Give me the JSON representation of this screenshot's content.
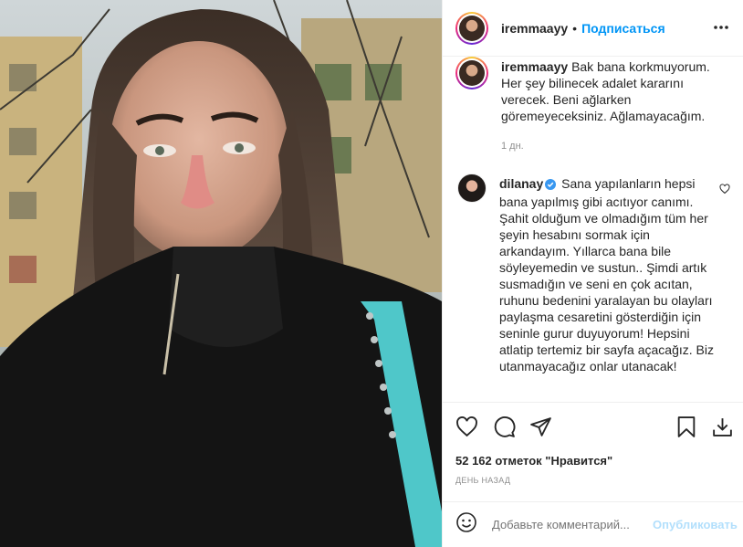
{
  "header": {
    "username": "iremmaayy",
    "separator": "•",
    "follow_label": "Подписаться",
    "more_icon": "more-horizontal-icon"
  },
  "comments": [
    {
      "username": "iremmaayy",
      "text": "Bak bana korkmuyorum. Her şey bilinecek adalet kararını verecek. Beni ağlarken göremeyeceksiniz. Ağlamayacağım.",
      "time": "1 дн."
    },
    {
      "username": "dilanay",
      "verified": true,
      "text": "Sana yapılanların hepsi bana yapılmış gibi acıtıyor canımı. Şahit olduğum ve olmadığım tüm her şeyin hesabını sormak için arkandayım. Yıllarca bana bile söyleyemedin ve sustun.. Şimdi artık susmadığın ve seni en çok acıtan, ruhunu bedenini yaralayan bu olayları paylaşma cesaretini gösterdiğin için seninle gurur duyuyorum! Hepsini atlatip tertemiz bir sayfa açacağız. Biz utanmayacağız onlar utanacak!"
    }
  ],
  "actions": {
    "likes_label": "52 162 отметок \"Нравится\"",
    "time_label": "ДЕНЬ НАЗАД"
  },
  "add_comment": {
    "placeholder": "Добавьте комментарий...",
    "post_label": "Опубликовать"
  },
  "colors": {
    "accent": "#0095f6",
    "muted": "#8e8e8e",
    "post_disabled": "#b2dffc"
  }
}
